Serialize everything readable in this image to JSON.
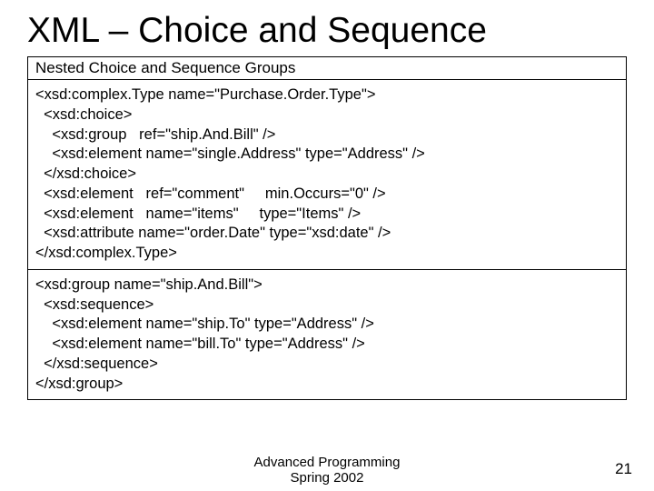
{
  "title": "XML – Choice and Sequence",
  "subtitle": "Nested Choice and Sequence Groups",
  "code_block1": "<xsd:complex.Type name=\"Purchase.Order.Type\">\n  <xsd:choice>\n    <xsd:group   ref=\"ship.And.Bill\" />\n    <xsd:element name=\"single.Address\" type=\"Address\" />\n  </xsd:choice>\n  <xsd:element   ref=\"comment\"     min.Occurs=\"0\" />\n  <xsd:element   name=\"items\"     type=\"Items\" />\n  <xsd:attribute name=\"order.Date\" type=\"xsd:date\" />\n</xsd:complex.Type>",
  "code_block2": "<xsd:group name=\"ship.And.Bill\">\n  <xsd:sequence>\n    <xsd:element name=\"ship.To\" type=\"Address\" />\n    <xsd:element name=\"bill.To\" type=\"Address\" />\n  </xsd:sequence>\n</xsd:group>",
  "footer_line1": "Advanced Programming",
  "footer_line2": "Spring 2002",
  "page_number": "21"
}
